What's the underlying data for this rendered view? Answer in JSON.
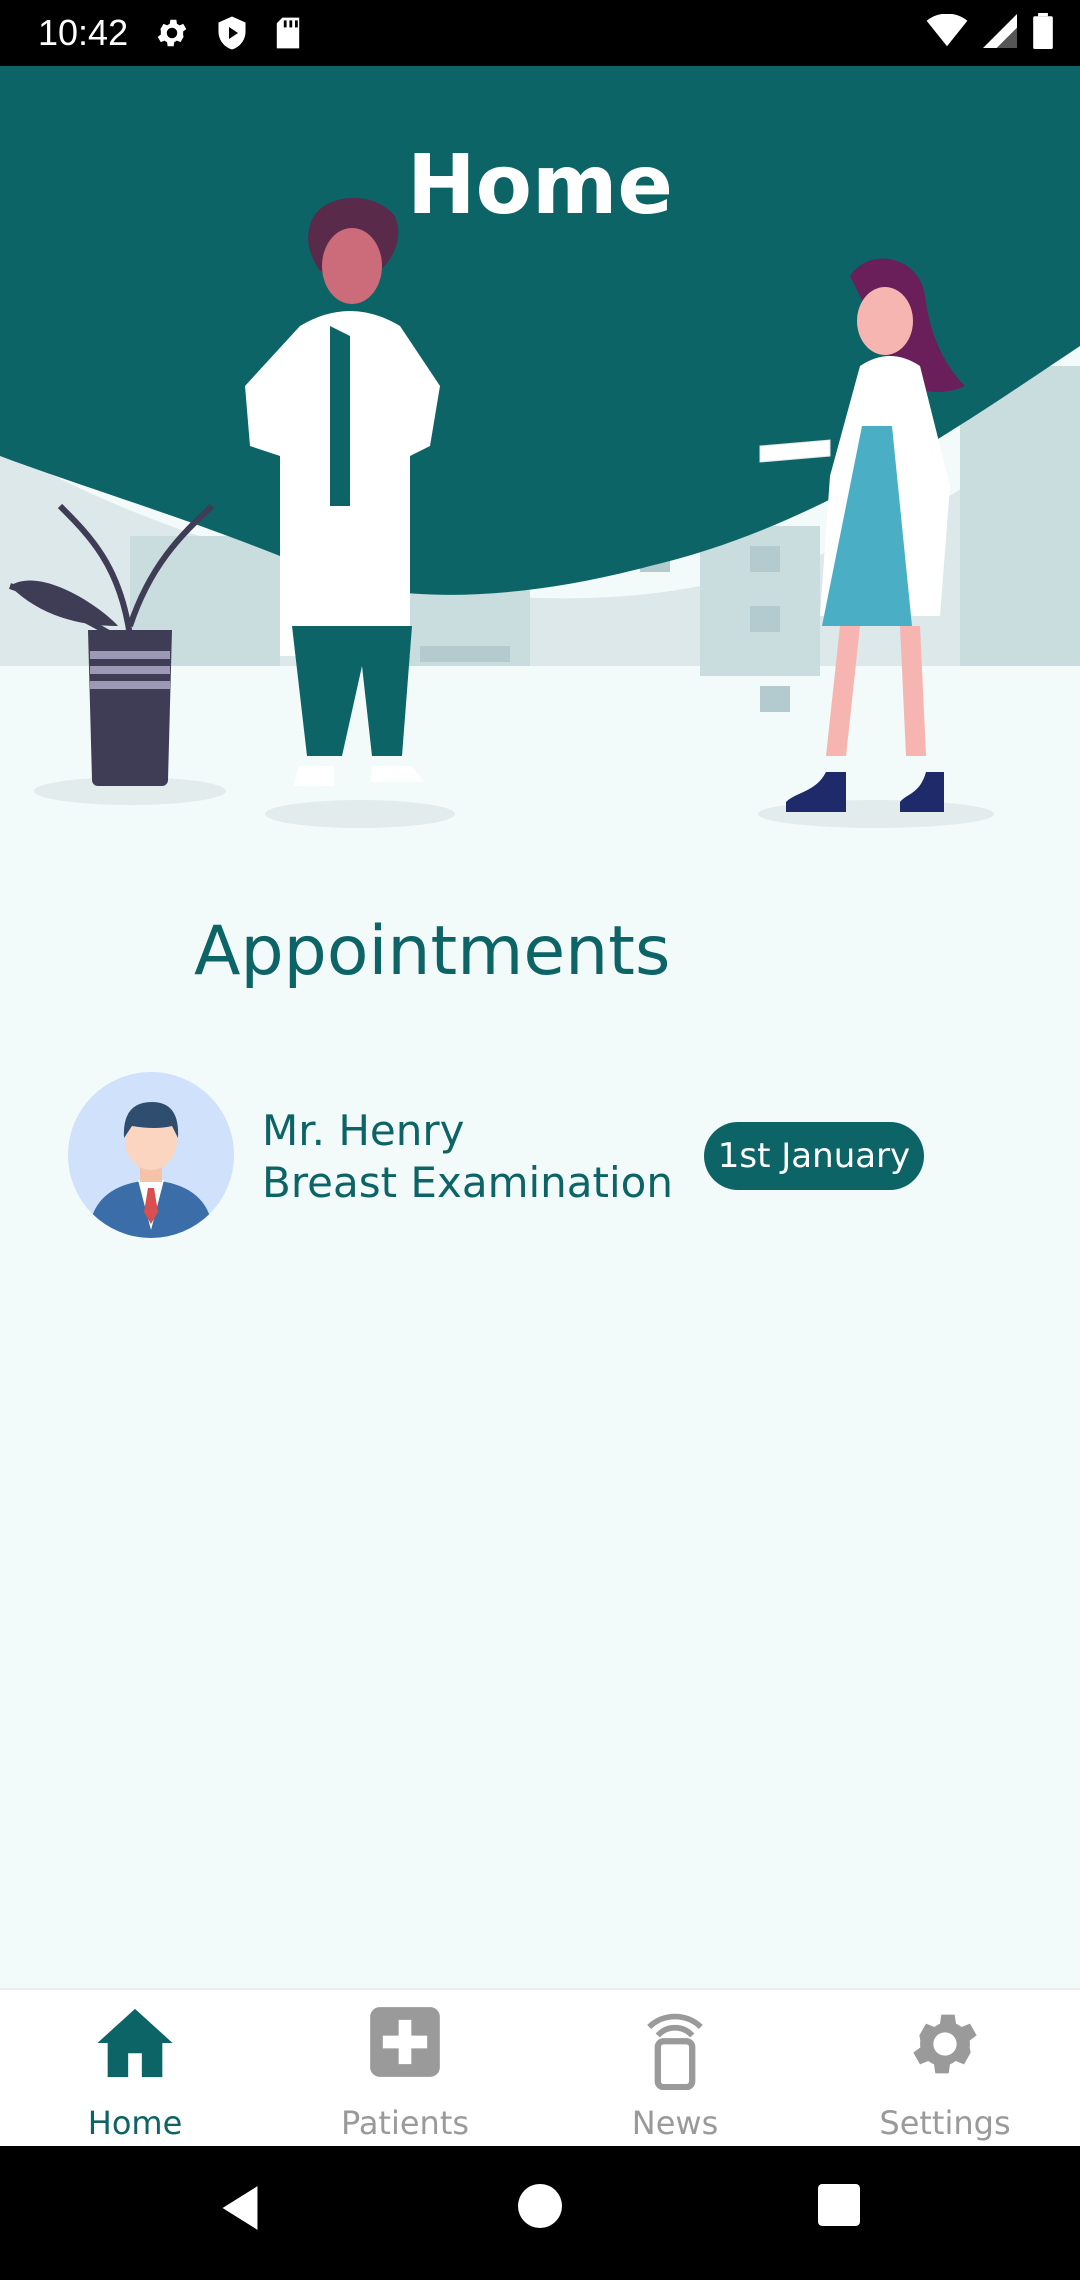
{
  "status": {
    "time": "10:42",
    "left_icons": [
      "gear-icon",
      "shield-icon",
      "sd-card-icon"
    ],
    "right_icons": [
      "wifi-icon",
      "signal-icon",
      "battery-icon"
    ]
  },
  "header": {
    "title": "Home",
    "color": "#0d6466"
  },
  "appointments": {
    "title": "Appointments",
    "items": [
      {
        "name": "Mr. Henry",
        "type": "Breast Examination",
        "date": "1st January"
      }
    ]
  },
  "nav": {
    "items": [
      {
        "label": "Home",
        "icon": "home-icon",
        "active": true
      },
      {
        "label": "Patients",
        "icon": "medical-plus-icon",
        "active": false
      },
      {
        "label": "News",
        "icon": "phone-broadcast-icon",
        "active": false
      },
      {
        "label": "Settings",
        "icon": "gear-icon",
        "active": false
      }
    ]
  },
  "colors": {
    "primary": "#0d6466",
    "background": "#f3fafa",
    "inactive": "#9a9a9a"
  }
}
